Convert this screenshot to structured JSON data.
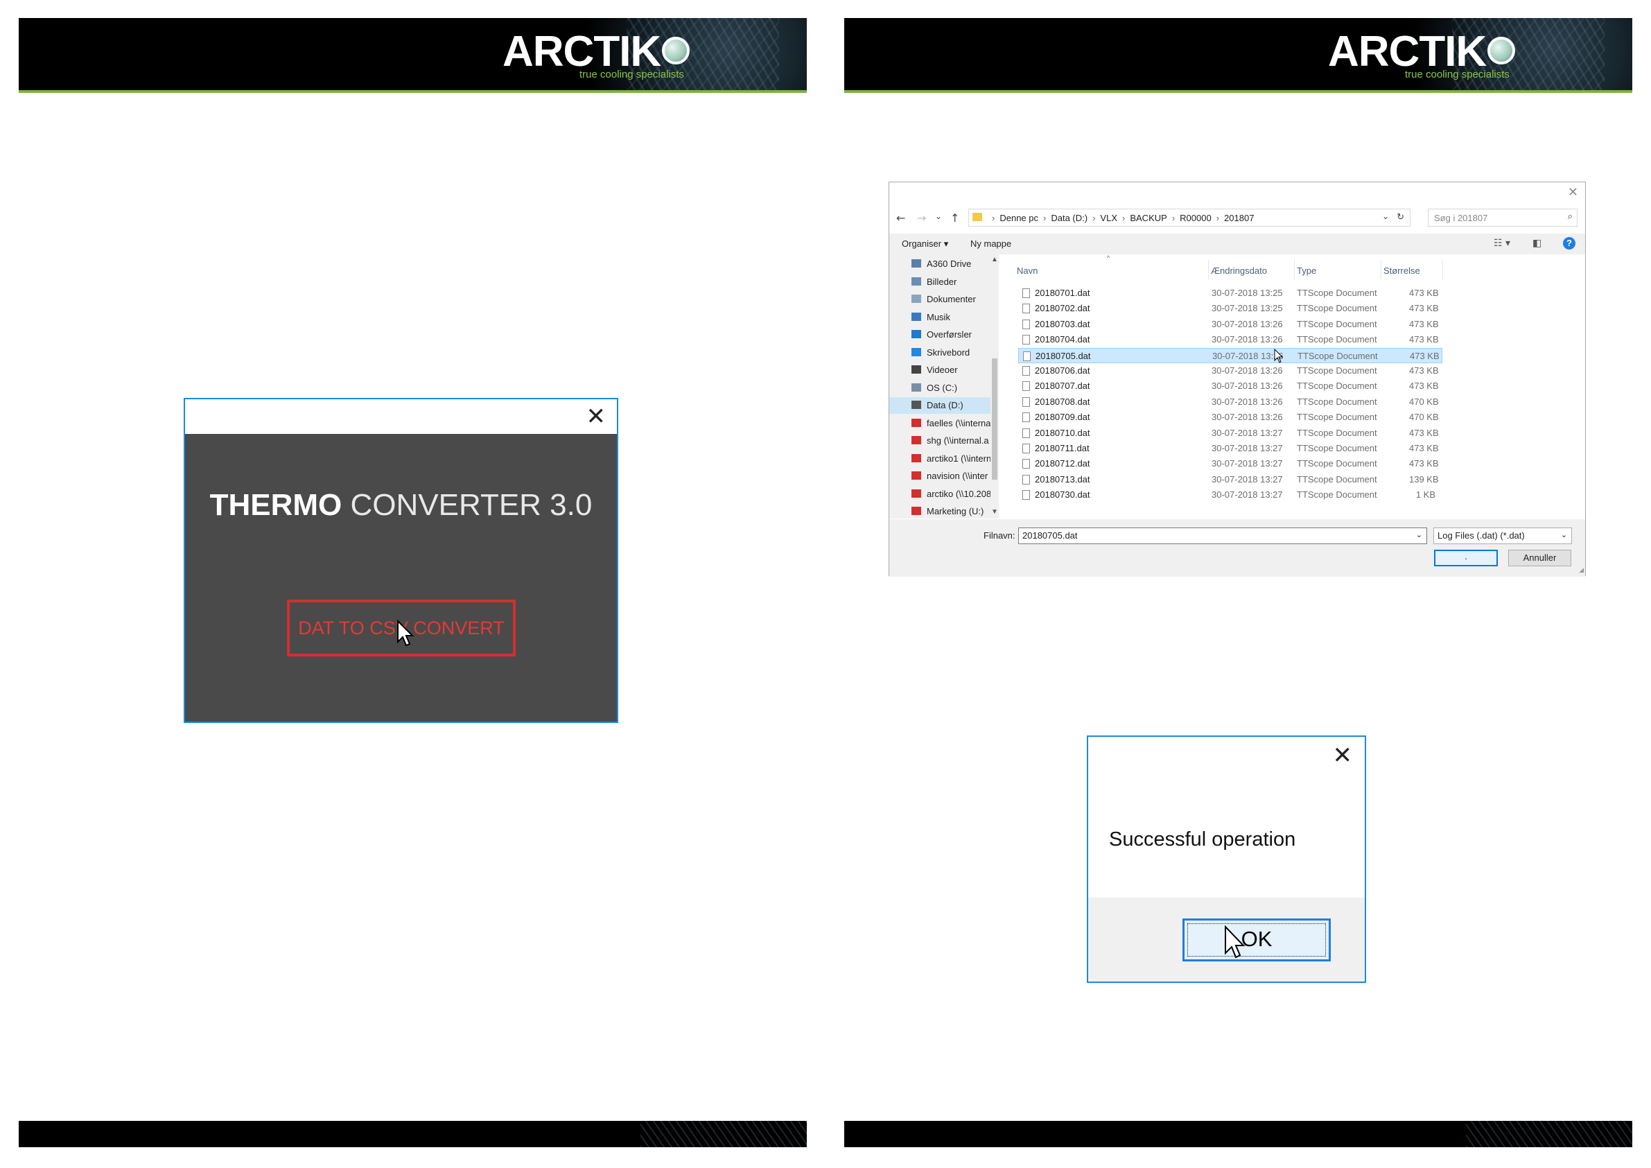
{
  "brand": {
    "logo_text": "ARCTIK",
    "tagline": "true cooling specialists"
  },
  "converter_window": {
    "close": "✕",
    "title_bold": "THERMO",
    "title_rest": " CONVERTER 3.0",
    "convert_button": "DAT TO CSV CONVERT"
  },
  "file_dialog": {
    "close": "✕",
    "nav": {
      "back": "←",
      "forward": "→",
      "recent": "⌄",
      "up": "↑"
    },
    "breadcrumbs": [
      "Denne pc",
      "Data (D:)",
      "VLX",
      "BACKUP",
      "R00000",
      "201807"
    ],
    "search_placeholder": "Søg i 201807",
    "toolbar": {
      "organize": "Organiser ▾",
      "new_folder": "Ny mappe",
      "help": "?"
    },
    "sidebar": [
      {
        "label": "A360 Drive",
        "icon": "cloud-icon",
        "color": "#5a7fa8"
      },
      {
        "label": "Billeder",
        "icon": "pictures-icon",
        "color": "#6a8db3"
      },
      {
        "label": "Dokumenter",
        "icon": "documents-icon",
        "color": "#8aa4c0"
      },
      {
        "label": "Musik",
        "icon": "music-icon",
        "color": "#3b78c4"
      },
      {
        "label": "Overførsler",
        "icon": "downloads-icon",
        "color": "#1e78d4"
      },
      {
        "label": "Skrivebord",
        "icon": "desktop-icon",
        "color": "#1e88e5"
      },
      {
        "label": "Videoer",
        "icon": "videos-icon",
        "color": "#444444"
      },
      {
        "label": "OS (C:)",
        "icon": "drive-icon",
        "color": "#7a8fa6"
      },
      {
        "label": "Data (D:)",
        "icon": "drive-icon",
        "color": "#555555"
      },
      {
        "label": "faelles (\\\\interna",
        "icon": "network-drive-icon",
        "color": "#d32f2f"
      },
      {
        "label": "shg (\\\\internal.a",
        "icon": "network-drive-icon",
        "color": "#d32f2f"
      },
      {
        "label": "arctiko1 (\\\\intern",
        "icon": "network-drive-icon",
        "color": "#d32f2f"
      },
      {
        "label": "navision (\\\\inter",
        "icon": "network-drive-icon",
        "color": "#d32f2f"
      },
      {
        "label": "arctiko (\\\\10.208",
        "icon": "network-drive-icon",
        "color": "#d32f2f"
      },
      {
        "label": "Marketing (U:)",
        "icon": "network-drive-icon",
        "color": "#d32f2f"
      }
    ],
    "selected_sidebar": "Data (D:)",
    "columns": {
      "name": "Navn",
      "date": "Ændringsdato",
      "type": "Type",
      "size": "Størrelse"
    },
    "files": [
      {
        "name": "20180701.dat",
        "date": "30-07-2018 13:25",
        "type": "TTScope Document",
        "size": "473 KB"
      },
      {
        "name": "20180702.dat",
        "date": "30-07-2018 13:25",
        "type": "TTScope Document",
        "size": "473 KB"
      },
      {
        "name": "20180703.dat",
        "date": "30-07-2018 13:26",
        "type": "TTScope Document",
        "size": "473 KB"
      },
      {
        "name": "20180704.dat",
        "date": "30-07-2018 13:26",
        "type": "TTScope Document",
        "size": "473 KB"
      },
      {
        "name": "20180705.dat",
        "date": "30-07-2018 13:26",
        "type": "TTScope Document",
        "size": "473 KB"
      },
      {
        "name": "20180706.dat",
        "date": "30-07-2018 13:26",
        "type": "TTScope Document",
        "size": "473 KB"
      },
      {
        "name": "20180707.dat",
        "date": "30-07-2018 13:26",
        "type": "TTScope Document",
        "size": "473 KB"
      },
      {
        "name": "20180708.dat",
        "date": "30-07-2018 13:26",
        "type": "TTScope Document",
        "size": "470 KB"
      },
      {
        "name": "20180709.dat",
        "date": "30-07-2018 13:26",
        "type": "TTScope Document",
        "size": "470 KB"
      },
      {
        "name": "20180710.dat",
        "date": "30-07-2018 13:27",
        "type": "TTScope Document",
        "size": "473 KB"
      },
      {
        "name": "20180711.dat",
        "date": "30-07-2018 13:27",
        "type": "TTScope Document",
        "size": "473 KB"
      },
      {
        "name": "20180712.dat",
        "date": "30-07-2018 13:27",
        "type": "TTScope Document",
        "size": "473 KB"
      },
      {
        "name": "20180713.dat",
        "date": "30-07-2018 13:27",
        "type": "TTScope Document",
        "size": "139 KB"
      },
      {
        "name": "20180730.dat",
        "date": "30-07-2018 13:27",
        "type": "TTScope Document",
        "size": "1 KB"
      }
    ],
    "selected_file": "20180705.dat",
    "filename_label": "Filnavn:",
    "filename_value": "20180705.dat",
    "filetype_value": "Log Files (.dat) (*.dat)",
    "open_button": "·",
    "cancel_button": "Annuller"
  },
  "message_box": {
    "close": "✕",
    "message": "Successful operation",
    "ok_button": "OK"
  },
  "colors": {
    "accent_blue": "#1e88e5",
    "convert_red": "#d32f2f",
    "brand_green": "#8bc34a"
  }
}
